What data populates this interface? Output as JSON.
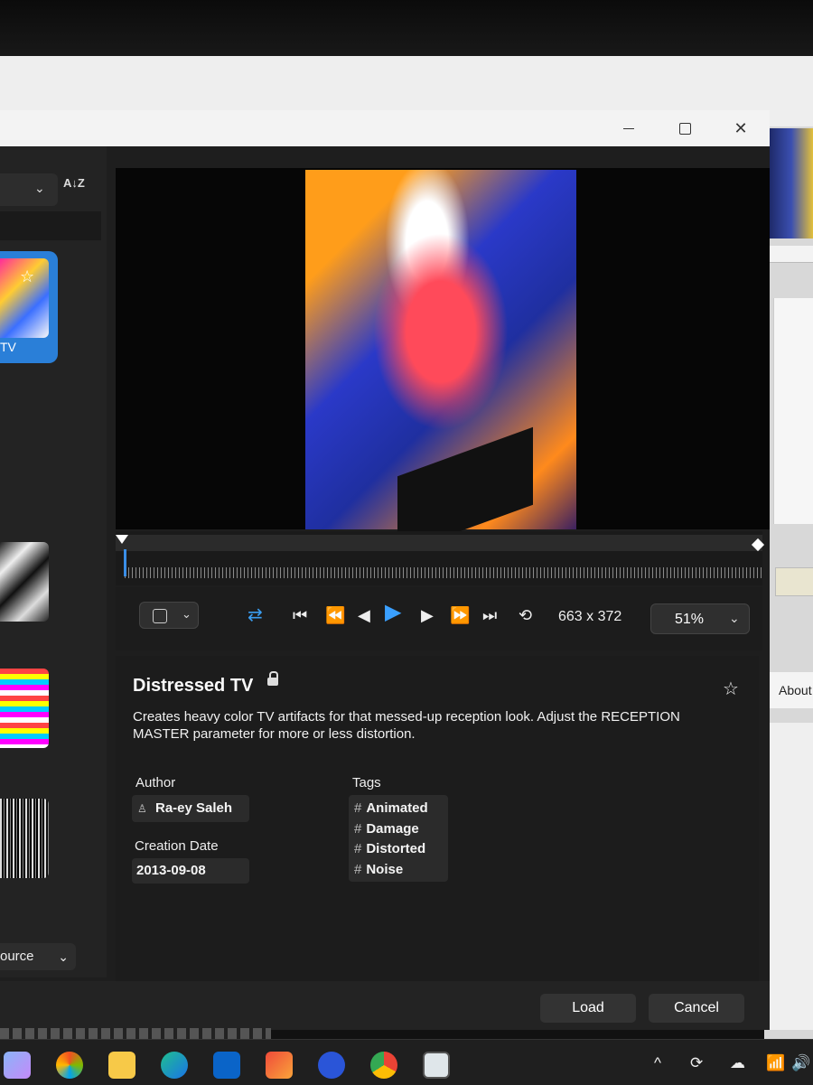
{
  "window": {
    "minimize_icon": "minimize-icon",
    "maximize_icon": "maximize-icon",
    "close_glyph": "✕"
  },
  "browser": {
    "sort_icon": "sort-az-icon",
    "sort_glyph": "A↓Z",
    "selected_item": {
      "label": "TV",
      "star_glyph": "☆"
    },
    "source_label": "ource"
  },
  "preview": {
    "dimensions": "663 x 372",
    "zoom": "51%"
  },
  "transport": {
    "shuffle": "⇄",
    "first": "⏮",
    "rewind": "⏪",
    "prev_frame": "◀",
    "play": "▶",
    "next_frame": "▶",
    "fast_forward": "⏩",
    "last": "⏭",
    "loop": "⟲"
  },
  "effect": {
    "title": "Distressed TV",
    "description": "Creates heavy  color TV artifacts for that messed-up reception look.  Adjust the RECEPTION MASTER parameter for more or less distortion.",
    "author_label": "Author",
    "author": "Ra-ey Saleh",
    "date_label": "Creation Date",
    "date": "2013-09-08",
    "tags_label": "Tags",
    "tags": [
      "Animated",
      "Damage",
      "Distorted",
      "Noise"
    ],
    "star_glyph": "☆"
  },
  "buttons": {
    "load": "Load",
    "cancel": "Cancel"
  },
  "background_app": {
    "about_label": "About"
  },
  "taskbar": {
    "tray_up": "^",
    "wifi": "📶",
    "volume": "🔊"
  },
  "colors": {
    "accent": "#2a7fd8",
    "play": "#3aa0ff",
    "dialog_bg": "#1e1e1e"
  }
}
